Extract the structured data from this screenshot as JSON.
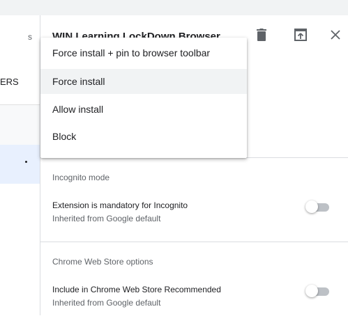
{
  "left_panel": {
    "frag_1": "s",
    "frag_2": "ERS"
  },
  "header": {
    "title": "WIN Learning LockDown Browser",
    "icons": [
      "delete-icon",
      "open-in-new-icon",
      "close-icon"
    ]
  },
  "install_menu": {
    "items": [
      "Force install + pin to browser toolbar",
      "Force install",
      "Allow install",
      "Block"
    ],
    "selected": "Force install"
  },
  "incognito_section": {
    "heading": "Incognito mode",
    "setting_title": "Extension is mandatory for Incognito",
    "setting_sub": "Inherited from Google default",
    "toggle_on": false
  },
  "cws_section": {
    "heading": "Chrome Web Store options",
    "setting_title": "Include in Chrome Web Store Recommended",
    "setting_sub": "Inherited from Google default",
    "toggle_on": false
  },
  "colors": {
    "toggle_track": "#bdc1c6",
    "menu_selected": "#f1f3f4",
    "left_selected": "#e8f0fe",
    "icon": "#5f6368"
  }
}
